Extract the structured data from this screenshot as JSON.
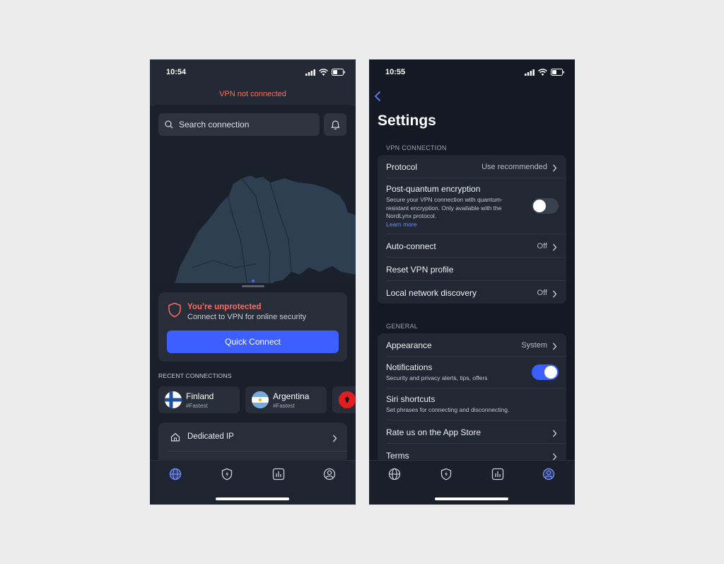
{
  "left_phone": {
    "status_time": "10:54",
    "vpn_status": "VPN not connected",
    "search_placeholder": "Search connection",
    "protection": {
      "title": "You’re unprotected",
      "subtitle": "Connect to VPN for online security",
      "button_label": "Quick Connect"
    },
    "recent_label": "RECENT CONNECTIONS",
    "recent": [
      {
        "country": "Finland",
        "tag": "#Fastest"
      },
      {
        "country": "Argentina",
        "tag": "#Fastest"
      }
    ],
    "dedicated_ip_label": "Dedicated IP",
    "colors": {
      "accent": "#3e5fff",
      "danger": "#ff6b5e",
      "background": "#1a1f29"
    },
    "tabs": [
      "globe-icon",
      "shield-bolt-icon",
      "stats-icon",
      "profile-icon"
    ],
    "active_tab": 0
  },
  "right_phone": {
    "status_time": "10:55",
    "title": "Settings",
    "vpn_connection": {
      "label": "VPN CONNECTION",
      "protocol": {
        "title": "Protocol",
        "value": "Use recommended"
      },
      "pq": {
        "title": "Post-quantum encryption",
        "desc1": "Secure your VPN connection with quantum-",
        "desc2": "resistant encryption. Only available with the",
        "desc3": "NordLynx protocol.",
        "link": "Learn more",
        "enabled": false
      },
      "auto_connect": {
        "title": "Auto-connect",
        "value": "Off"
      },
      "reset": {
        "title": "Reset VPN profile"
      },
      "local_network": {
        "title": "Local network discovery",
        "value": "Off"
      }
    },
    "general": {
      "label": "GENERAL",
      "appearance": {
        "title": "Appearance",
        "value": "System"
      },
      "notifications": {
        "title": "Notifications",
        "desc": "Security and privacy alerts, tips, offers",
        "enabled": true
      },
      "siri": {
        "title": "Siri shortcuts",
        "desc": "Set phrases for connecting and disconnecting."
      },
      "rate": {
        "title": "Rate us on the App Store"
      },
      "terms": {
        "title": "Terms"
      }
    },
    "tabs": [
      "globe-icon",
      "shield-bolt-icon",
      "stats-icon",
      "profile-icon"
    ],
    "active_tab": 3
  }
}
